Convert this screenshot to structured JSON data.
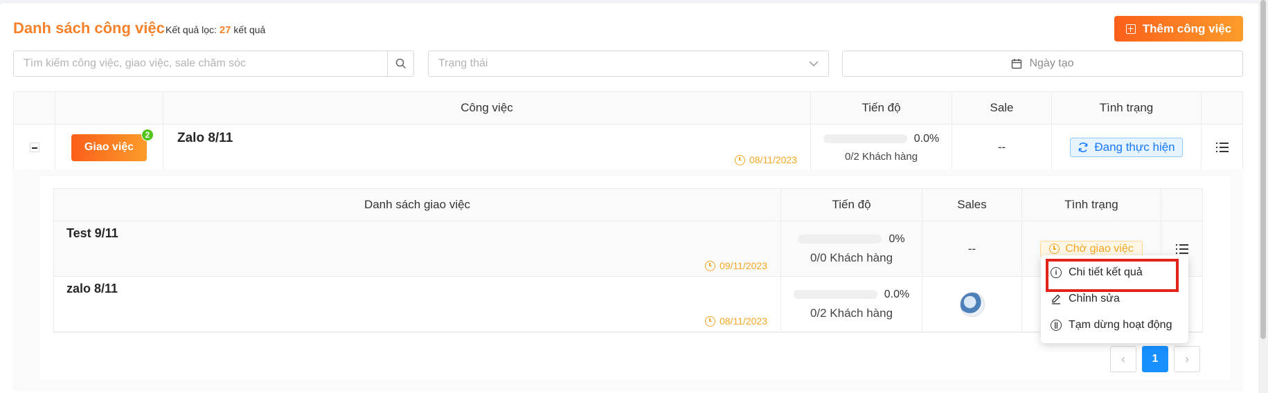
{
  "header": {
    "title": "Danh sách công việc",
    "filter_label": "Kết quả lọc:",
    "filter_count": "27",
    "filter_suffix": "kết quả",
    "add_button": "Thêm công việc"
  },
  "filters": {
    "search_placeholder": "Tìm kiếm công việc, giao việc, sale chăm sóc",
    "status_placeholder": "Trạng thái",
    "date_label": "Ngày tạo"
  },
  "table": {
    "columns": [
      "Công việc",
      "Tiến độ",
      "Sale",
      "Tình trạng"
    ],
    "row": {
      "assign_button": "Giao việc",
      "badge": "2",
      "title": "Zalo 8/11",
      "date": "08/11/2023",
      "progress_percent": "0.0%",
      "progress_value": 0.0,
      "customers": "0/2 Khách hàng",
      "sale": "--",
      "status": "Đang thực hiện"
    }
  },
  "subtable": {
    "columns": [
      "Danh sách giao việc",
      "Tiến độ",
      "Sales",
      "Tình trạng"
    ],
    "rows": [
      {
        "title": "Test 9/11",
        "date": "09/11/2023",
        "progress_percent": "0%",
        "progress_value": 0,
        "customers": "0/0 Khách hàng",
        "sales": "--",
        "status": "Chờ giao việc"
      },
      {
        "title": "zalo 8/11",
        "date": "08/11/2023",
        "progress_percent": "0.0%",
        "progress_value": 0.0,
        "customers": "0/2 Khách hàng",
        "sales": "avatar"
      }
    ]
  },
  "pagination": {
    "current": "1",
    "prev": "‹",
    "next": "›"
  },
  "context_menu": {
    "items": [
      {
        "label": "Chi tiết kết quả",
        "icon": "info-icon"
      },
      {
        "label": "Chỉnh sửa",
        "icon": "edit-icon"
      },
      {
        "label": "Tạm dừng hoạt động",
        "icon": "pause-icon"
      }
    ]
  },
  "colors": {
    "accent_orange": "#f5812b",
    "status_blue": "#1677ff",
    "status_orange": "#f5a623",
    "highlight_red": "#e2231a"
  }
}
